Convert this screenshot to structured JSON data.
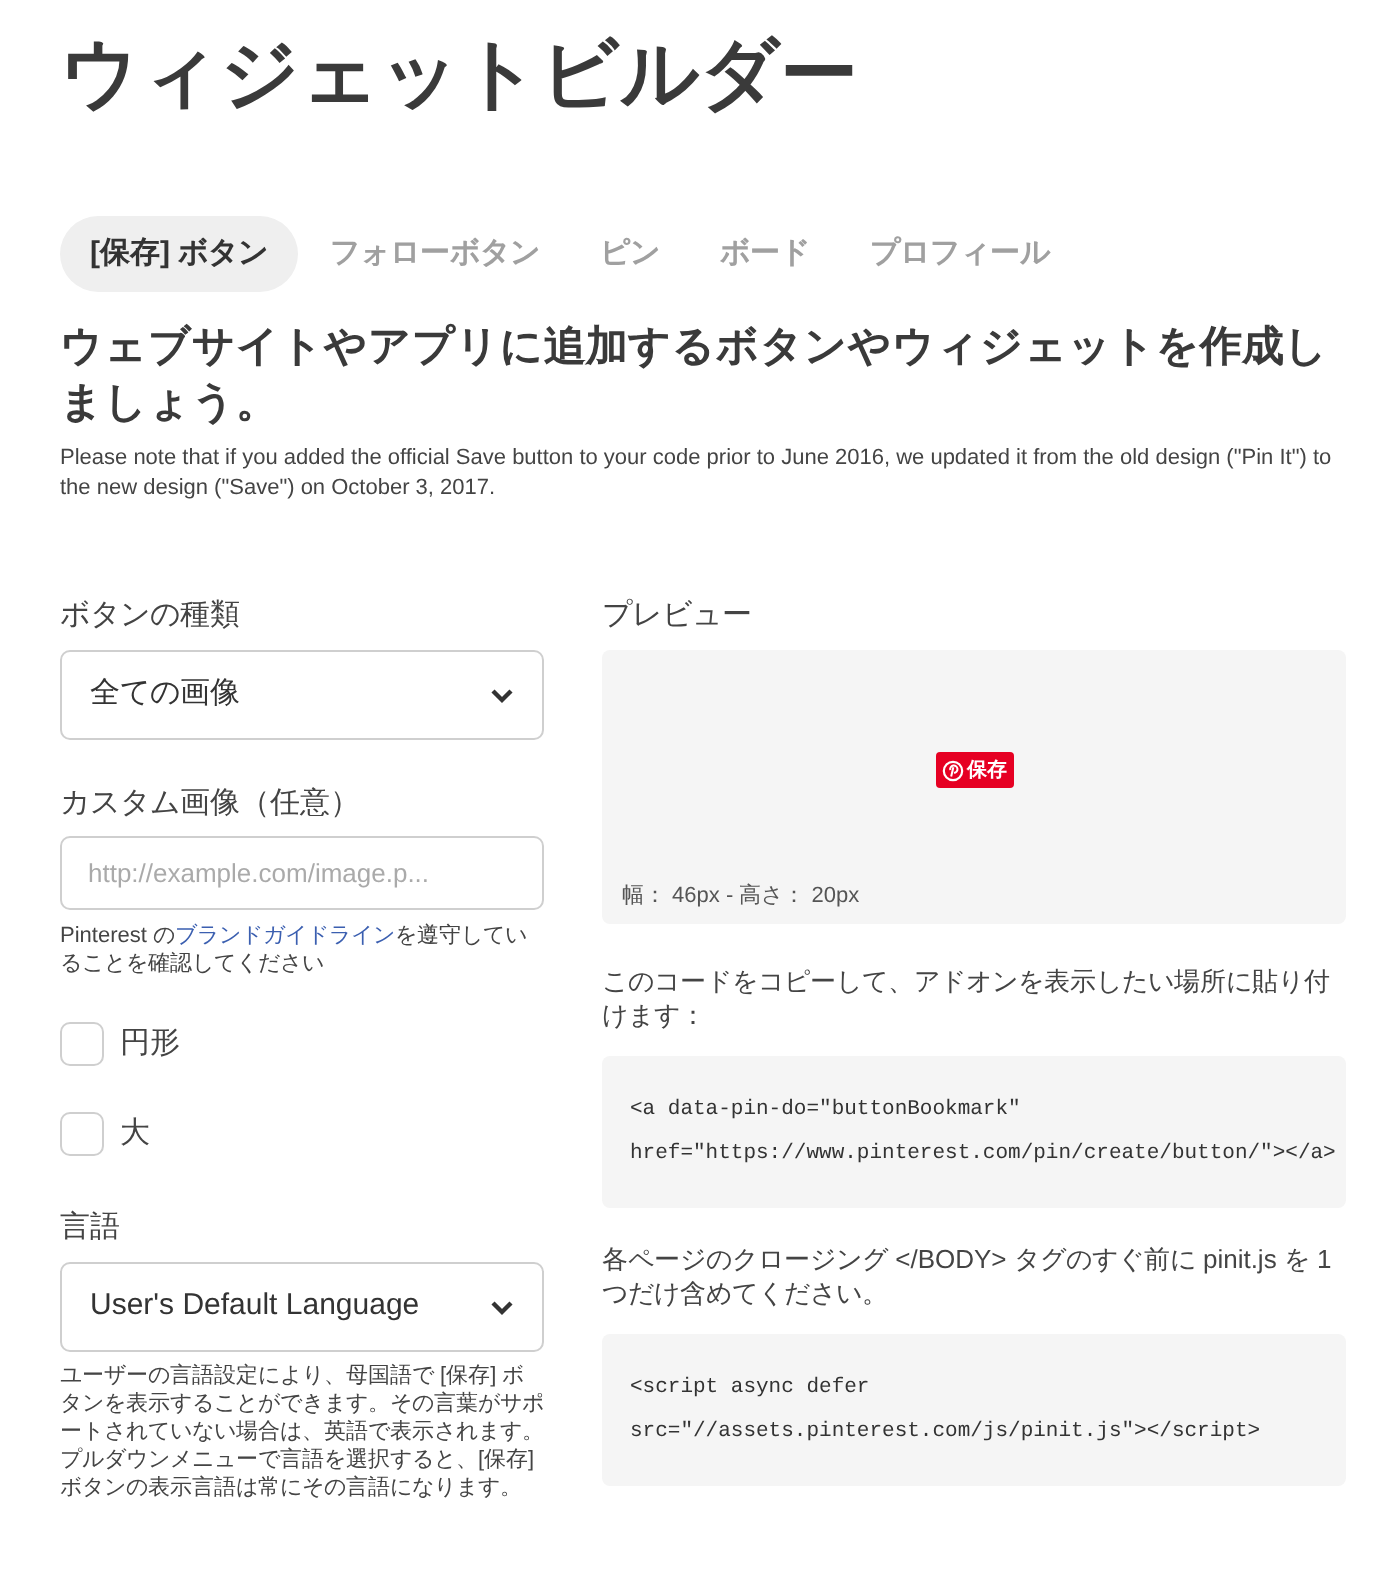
{
  "page_title": "ウィジェットビルダー",
  "tabs": [
    {
      "label": "[保存] ボタン",
      "selected": true
    },
    {
      "label": "フォローボタン",
      "selected": false
    },
    {
      "label": "ピン",
      "selected": false
    },
    {
      "label": "ボード",
      "selected": false
    },
    {
      "label": "プロフィール",
      "selected": false
    }
  ],
  "heading": "ウェブサイトやアプリに追加するボタンやウィジェットを作成しましょう。",
  "note": "Please note that if you added the official Save button to your code prior to June 2016, we updated it from the old design (\"Pin It\") to the new design (\"Save\") on October 3, 2017.",
  "button_type": {
    "label": "ボタンの種類",
    "value": "全ての画像"
  },
  "custom_image": {
    "label": "カスタム画像（任意）",
    "placeholder": "http://example.com/image.p...",
    "help_before": "Pinterest の",
    "help_link": "ブランドガイドライン",
    "help_after": "を遵守していることを確認してください"
  },
  "options": [
    {
      "label": "円形",
      "checked": false
    },
    {
      "label": "大",
      "checked": false
    }
  ],
  "language": {
    "label": "言語",
    "value": "User's Default Language",
    "help": "ユーザーの言語設定により、母国語で [保存] ボタンを表示することができます。その言葉がサポートされていない場合は、英語で表示されます。プルダウンメニューで言語を選択すると、[保存] ボタンの表示言語は常にその言語になります。"
  },
  "preview": {
    "label": "プレビュー",
    "button_label": "保存",
    "size": "幅： 46px - 高さ： 20px"
  },
  "code_instruction": "このコードをコピーして、アドオンを表示したい場所に貼り付けます：",
  "code_lines": [
    "<a data-pin-do=\"buttonBookmark\"",
    "href=\"https://www.pinterest.com/pin/create/button/\"></a>"
  ],
  "script_instruction": "各ページのクロージング </BODY> タグのすぐ前に pinit.js を 1 つだけ含めてください。",
  "script_lines": [
    "<script async defer",
    "src=\"//assets.pinterest.com/js/pinit.js\"></script>"
  ]
}
